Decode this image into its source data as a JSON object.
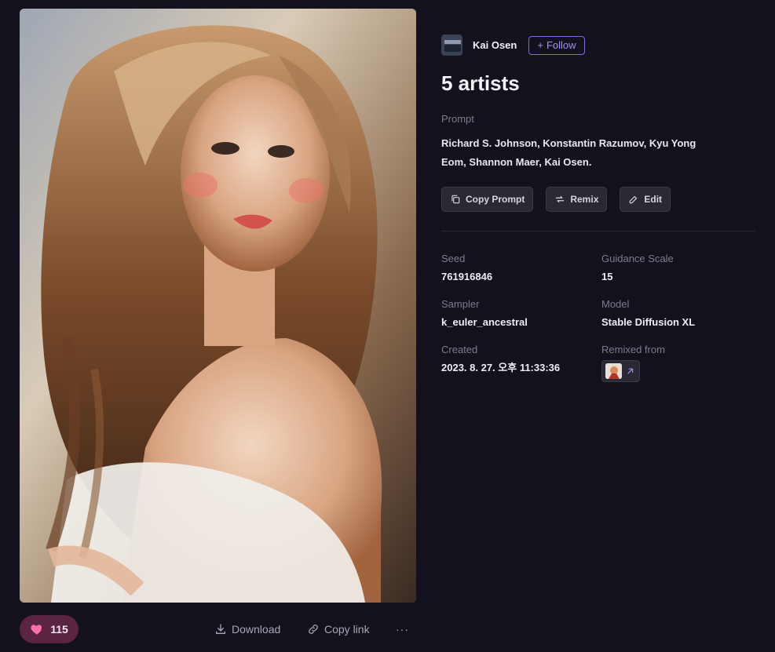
{
  "author": {
    "name": "Kai Osen",
    "follow_label": "Follow"
  },
  "title": "5 artists",
  "prompt": {
    "label": "Prompt",
    "text": "Richard S. Johnson, Konstantin Razumov, Kyu Yong Eom, Shannon Maer, Kai Osen."
  },
  "buttons": {
    "copy_prompt": "Copy Prompt",
    "remix": "Remix",
    "edit": "Edit"
  },
  "meta": {
    "seed_label": "Seed",
    "seed": "761916846",
    "guidance_label": "Guidance Scale",
    "guidance": "15",
    "sampler_label": "Sampler",
    "sampler": "k_euler_ancestral",
    "model_label": "Model",
    "model": "Stable Diffusion XL",
    "created_label": "Created",
    "created": "2023. 8. 27. 오후 11:33:36",
    "remixed_label": "Remixed from"
  },
  "footer": {
    "likes": "115",
    "download_label": "Download",
    "copy_link_label": "Copy link",
    "more_label": "···"
  },
  "colors": {
    "accent": "#7c6cf0",
    "like_bg": "#5b2440",
    "heart": "#ff6fa8",
    "background": "#13121c"
  }
}
